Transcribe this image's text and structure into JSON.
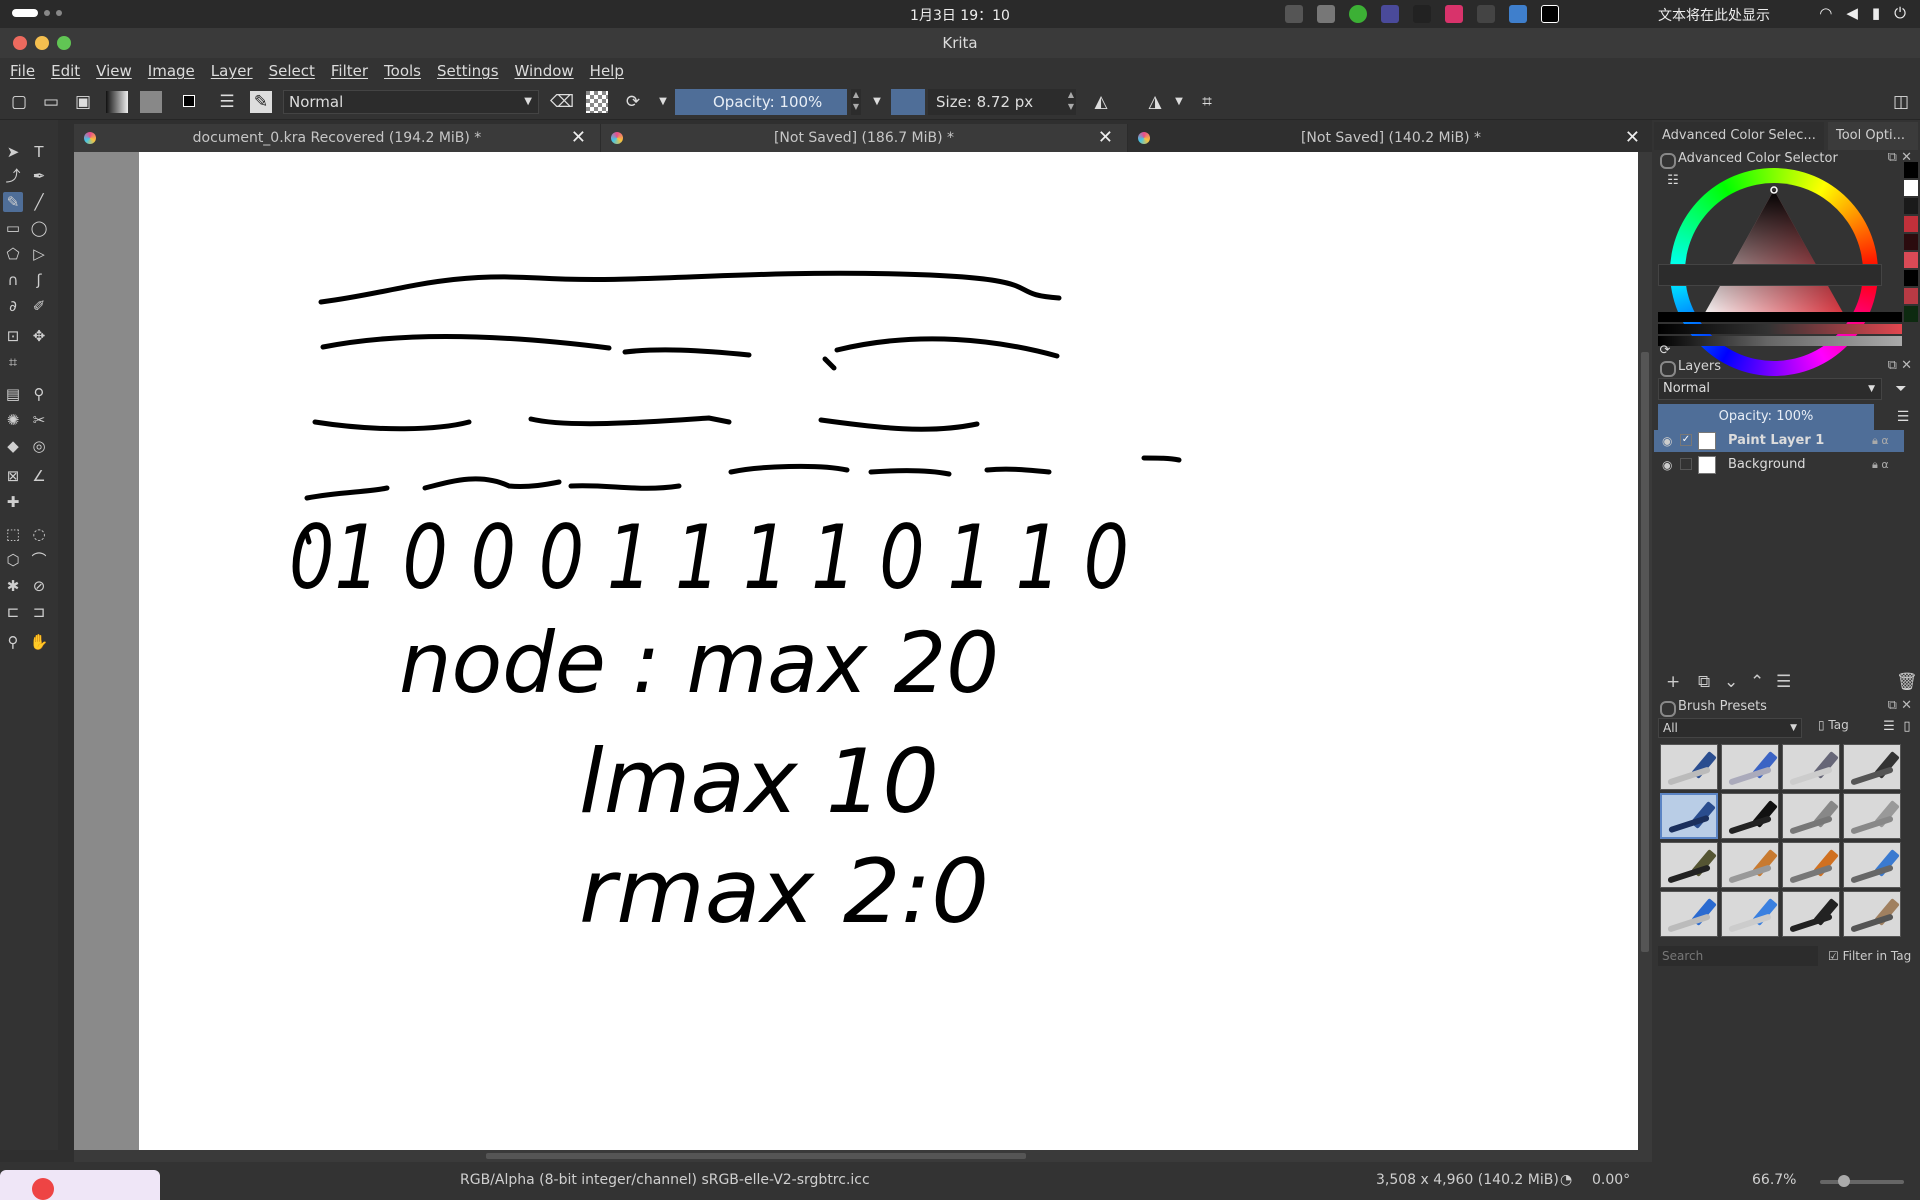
{
  "system": {
    "clock": "1月3日  19：10",
    "notice": "文本将在此处显示"
  },
  "window": {
    "title": "Krita"
  },
  "menu": [
    "File",
    "Edit",
    "View",
    "Image",
    "Layer",
    "Select",
    "Filter",
    "Tools",
    "Settings",
    "Window",
    "Help"
  ],
  "toolbar": {
    "blend_mode": "Normal",
    "opacity_label": "Opacity: 100%",
    "size_label": "Size: 8.72 px"
  },
  "tabs": [
    {
      "label": "document_0.kra Recovered (194.2 MiB) *"
    },
    {
      "label": "[Not Saved]  (186.7 MiB) *"
    },
    {
      "label": "[Not Saved]  (140.2 MiB) *"
    }
  ],
  "dock": {
    "tab_color": "Advanced Color Selec...",
    "tab_tool": "Tool Opti...",
    "color_title": "Advanced Color Selector",
    "layers_title": "Layers",
    "layers_blend": "Normal",
    "layers_opacity": "Opacity:  100%",
    "layers": [
      {
        "name": "Paint Layer 1",
        "selected": true
      },
      {
        "name": "Background",
        "selected": false
      }
    ],
    "brush_title": "Brush Presets",
    "brush_filter": "All",
    "brush_tag": "Tag",
    "brush_search": "Search",
    "filter_in_tag": "Filter in Tag"
  },
  "status": {
    "color_space": "RGB/Alpha (8-bit integer/channel)  sRGB-elle-V2-srgbtrc.icc",
    "dimensions": "3,508 x 4,960 (140.2 MiB)",
    "rotation": "0.00°",
    "zoom": "66.7%"
  },
  "canvas_text": {
    "line1": "01  0 0 0  1 1 1 1 0 1 1 0",
    "line2": "node : max  20",
    "line3": "lmax   10",
    "line4": "rmax   2:0"
  },
  "colors": {
    "accent": "#4f6e98",
    "panel": "#333333",
    "canvas": "#ffffff"
  }
}
